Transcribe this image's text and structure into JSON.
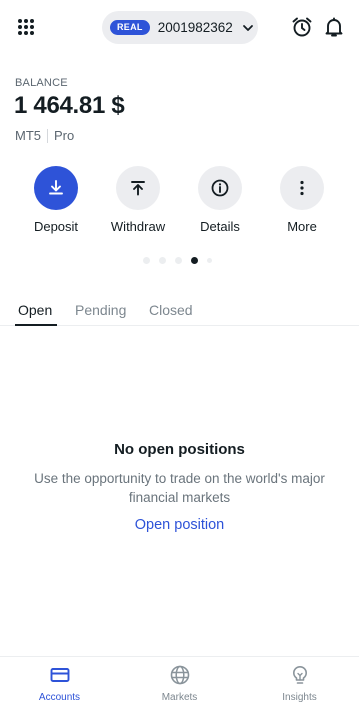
{
  "header": {
    "account_type": "REAL",
    "account_number": "2001982362"
  },
  "balance": {
    "label": "BALANCE",
    "value": "1 464.81 $",
    "platform": "MT5",
    "account_kind": "Pro"
  },
  "actions": [
    {
      "label": "Deposit",
      "icon": "download-icon",
      "primary": true
    },
    {
      "label": "Withdraw",
      "icon": "upload-icon",
      "primary": false
    },
    {
      "label": "Details",
      "icon": "info-icon",
      "primary": false
    },
    {
      "label": "More",
      "icon": "vertical-dots-icon",
      "primary": false
    }
  ],
  "pager": {
    "total": 5,
    "active_index": 3
  },
  "tabs": [
    {
      "label": "Open",
      "active": true
    },
    {
      "label": "Pending",
      "active": false
    },
    {
      "label": "Closed",
      "active": false
    }
  ],
  "empty_state": {
    "title": "No open positions",
    "subtitle": "Use the opportunity to trade on the world's major financial markets",
    "cta": "Open position"
  },
  "bottom_nav": [
    {
      "label": "Accounts",
      "icon": "card-icon",
      "active": true
    },
    {
      "label": "Markets",
      "icon": "globe-icon",
      "active": false
    },
    {
      "label": "Insights",
      "icon": "lightbulb-icon",
      "active": false
    }
  ],
  "colors": {
    "accent": "#2e53d8",
    "text": "#141d22",
    "muted": "#7d878f",
    "surface": "#ecedf0"
  }
}
